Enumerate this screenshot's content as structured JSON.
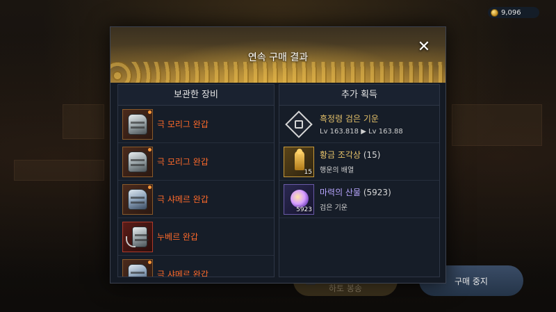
{
  "currency": {
    "amount": "9,096"
  },
  "modal": {
    "title": "연속 구매 결과",
    "close_label": "✕",
    "left_panel": {
      "title": "보관한 장비",
      "items": [
        {
          "name": "극 모리그 완갑"
        },
        {
          "name": "극 모리그 완갑"
        },
        {
          "name": "극 샤메르 완갑"
        },
        {
          "name": "누베르 완갑"
        },
        {
          "name": "극 샤메르 완갑"
        }
      ]
    },
    "right_panel": {
      "title": "추가 획득",
      "rewards": [
        {
          "title": "흑정령 검은 기운",
          "count": "",
          "sub": "Lv 163.818 ▶ Lv 163.88",
          "qty": ""
        },
        {
          "title": "황금 조각상",
          "count": "(15)",
          "sub": "행운의 배열",
          "qty": "15"
        },
        {
          "title": "마력의 산물",
          "count": "(5923)",
          "sub": "검은 기운",
          "qty": "5923"
        }
      ]
    }
  },
  "buttons": {
    "stop": "구매 중지",
    "other": "하토 봉송"
  },
  "colors": {
    "item_name": "#ff6a2a",
    "reward_gold": "#e6c26a",
    "reward_purple": "#b8a6ff",
    "panel_bg": "#161d28"
  }
}
